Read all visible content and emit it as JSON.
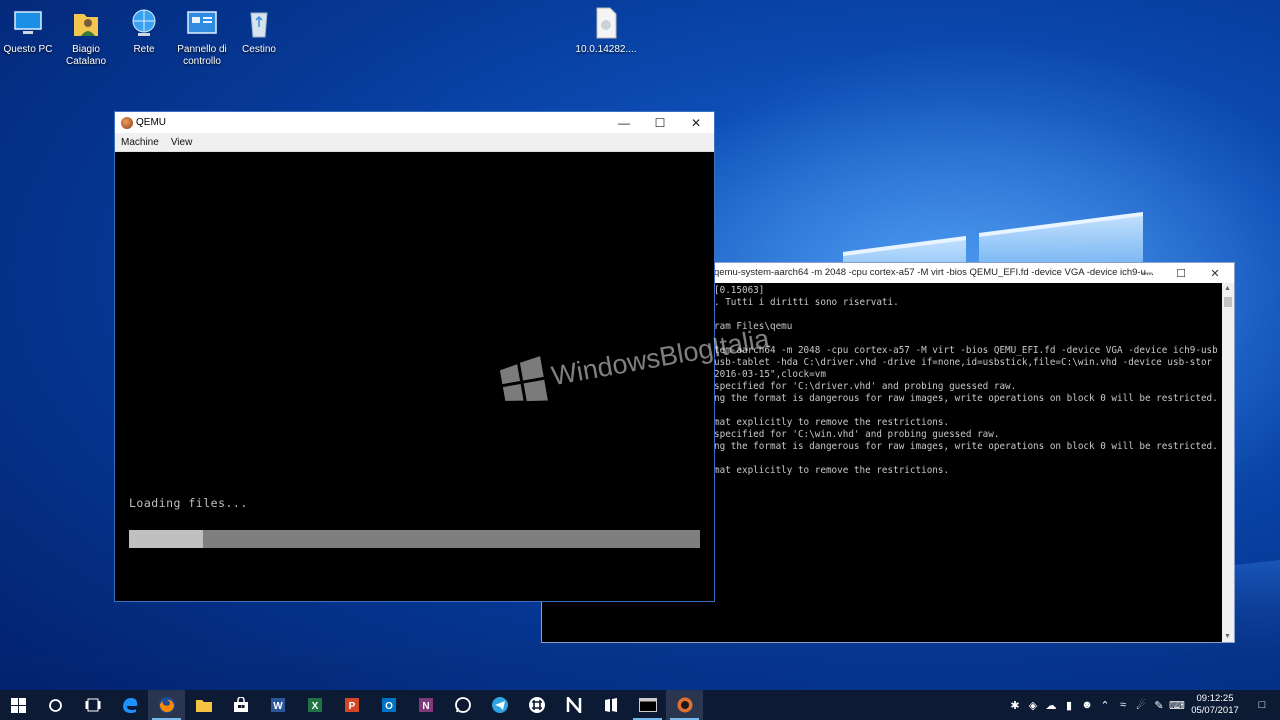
{
  "desktop": {
    "icons": [
      {
        "label": "Questo PC",
        "icon": "this-pc-icon"
      },
      {
        "label": "Biagio Catalano",
        "icon": "user-folder-icon"
      },
      {
        "label": "Rete",
        "icon": "network-icon"
      },
      {
        "label": "Pannello di controllo",
        "icon": "control-panel-icon"
      },
      {
        "label": "Cestino",
        "icon": "recycle-bin-icon"
      },
      {
        "label": "10.0.14282....",
        "icon": "file-icon"
      }
    ]
  },
  "qemu": {
    "title": "QEMU",
    "menu": [
      "Machine",
      "View"
    ],
    "loading_text": "Loading files...",
    "progress": 0.13
  },
  "console": {
    "title": "qemu-system-aarch64 -m 2048 -cpu cortex-a57 -M virt -bios QEMU_EFI.fd -device VGA -device ich9-u...",
    "lines": [
      "[0.15063]",
      ". Tutti i diritti sono riservati.",
      "",
      "ram Files\\qemu",
      "",
      "tem-aarch64 -m 2048 -cpu cortex-a57 -M virt -bios QEMU_EFI.fd -device VGA -device ich9-usb",
      "usb-tablet -hda C:\\driver.vhd -drive if=none,id=usbstick,file=C:\\win.vhd -device usb-stor",
      "2016-03-15\",clock=vm",
      "specified for 'C:\\driver.vhd' and probing guessed raw.",
      "ng the format is dangerous for raw images, write operations on block 0 will be restricted.",
      "",
      "mat explicitly to remove the restrictions.",
      "specified for 'C:\\win.vhd' and probing guessed raw.",
      "ng the format is dangerous for raw images, write operations on block 0 will be restricted.",
      "",
      "mat explicitly to remove the restrictions."
    ]
  },
  "watermark": "WindowsBlogItalia",
  "taskbar": {
    "apps": [
      "start-icon",
      "cortana-icon",
      "task-view-icon",
      "edge-icon",
      "firefox-icon",
      "file-explorer-icon",
      "store-icon",
      "word-icon",
      "excel-icon",
      "powerpoint-icon",
      "outlook-icon",
      "onenote-icon",
      "whatsapp-icon",
      "telegram-icon",
      "slack-icon",
      "n-app-icon",
      "windows-insider-icon",
      "console-icon",
      "qemu-icon"
    ],
    "time": "09:12:25",
    "date": "05/07/2017"
  },
  "colors": {
    "accent": "#0078d7",
    "desktop_bg": "#0a46a8"
  }
}
